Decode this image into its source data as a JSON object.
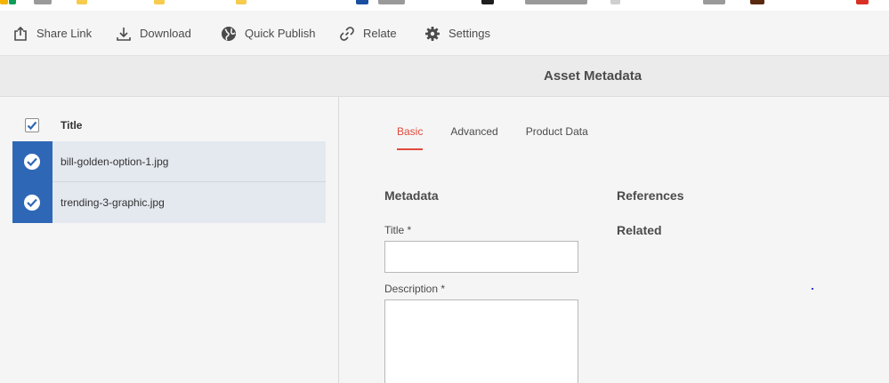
{
  "toolbar": {
    "share_link_label": "Share Link",
    "download_label": "Download",
    "quick_publish_label": "Quick Publish",
    "relate_label": "Relate",
    "settings_label": "Settings"
  },
  "page": {
    "title": "Asset Metadata"
  },
  "asset_list": {
    "header_label": "Title",
    "items": [
      {
        "name": "bill-golden-option-1.jpg",
        "selected": true
      },
      {
        "name": "trending-3-graphic.jpg",
        "selected": true
      }
    ]
  },
  "tabs": [
    {
      "label": "Basic",
      "active": true
    },
    {
      "label": "Advanced",
      "active": false
    },
    {
      "label": "Product Data",
      "active": false
    }
  ],
  "form": {
    "section_title": "Metadata",
    "title_label": "Title *",
    "title_value": "",
    "description_label": "Description *",
    "description_value": ""
  },
  "side": {
    "references_label": "References",
    "related_label": "Related"
  },
  "colors": {
    "accent": "#e14a3d",
    "selection_blue": "#2f67b7",
    "row_selected_bg": "#e4e8ef"
  }
}
